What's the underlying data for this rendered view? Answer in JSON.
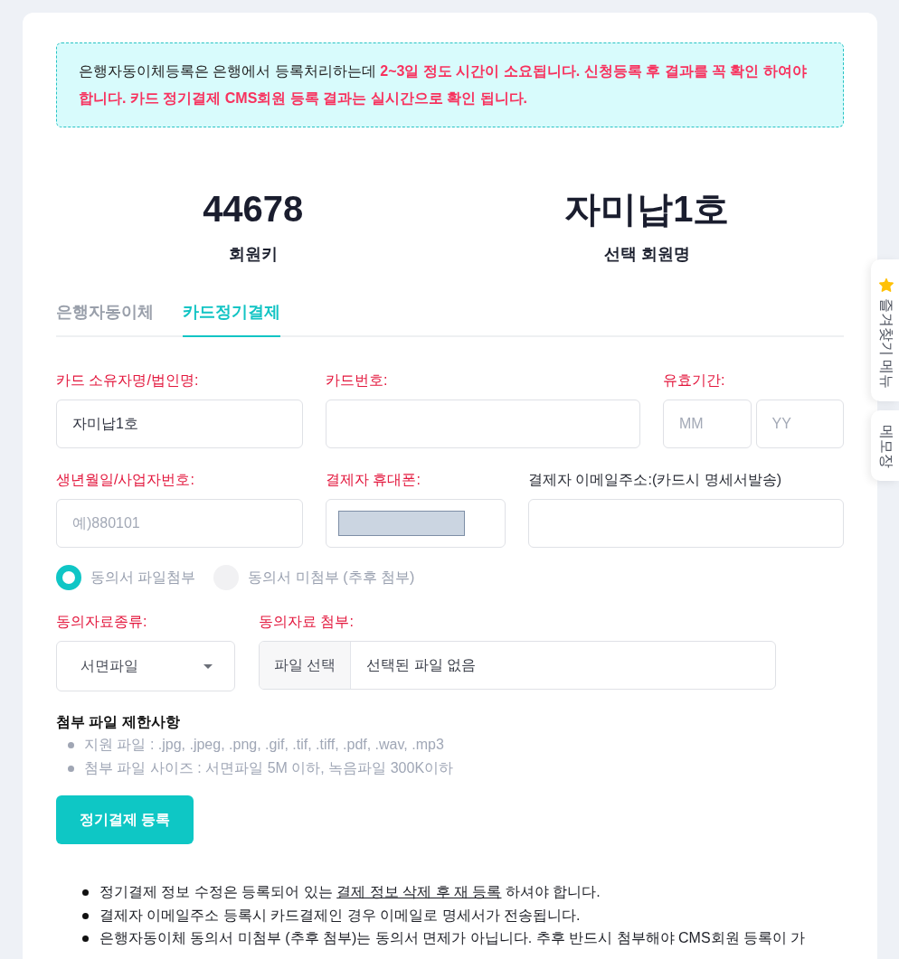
{
  "notice": {
    "parts": [
      {
        "text": "은행자동이체등록은 은행에서 등록처리하는데 ",
        "emphasis": false
      },
      {
        "text": "2~3일 정도 시간이 소요됩니다. 신청등록 후 결과를 꼭 확인 하여야 합니다. 카드 정기결제 CMS회원 등록 결과는 실시간으로 확인 됩니다.",
        "emphasis": true
      }
    ]
  },
  "summary": [
    {
      "value": "44678",
      "label": "회원키"
    },
    {
      "value": "자미납1호",
      "label": "선택 회원명"
    }
  ],
  "tabs": [
    {
      "label": "은행자동이체",
      "selected": false
    },
    {
      "label": "카드정기결제",
      "selected": true
    }
  ],
  "form_rows": [
    [
      {
        "kind": "text",
        "label": "카드 소유자명/법인명:",
        "required": true,
        "value": "자미납1호"
      },
      {
        "kind": "text",
        "label": "카드번호:",
        "required": true
      },
      {
        "kind": "pair",
        "label": "유효기간:",
        "required": true,
        "inputs": [
          {
            "placeholder": "MM"
          },
          {
            "placeholder": "YY"
          }
        ]
      }
    ],
    [
      {
        "kind": "text",
        "label": "생년월일/사업자번호:",
        "required": true,
        "placeholder": "예)880101"
      },
      {
        "kind": "text",
        "label": "결제자 휴대폰:",
        "required": true,
        "masked": true
      },
      {
        "kind": "text",
        "label": "결제자 이메일주소:(카드시 명세서발송)",
        "required": false
      }
    ]
  ],
  "attachment_options": [
    {
      "label": "동의서 파일첨부",
      "selected": true
    },
    {
      "label": "동의서 미첨부 (추후 첨부)",
      "selected": false
    }
  ],
  "consent_type": {
    "label": "동의자료종류:",
    "required": true,
    "value": "서면파일"
  },
  "consent_file": {
    "label": "동의자료 첨부:",
    "required": true,
    "button": "파일 선택",
    "status": "선택된 파일 없음"
  },
  "restrictions": {
    "title": "첨부 파일 제한사항",
    "items": [
      "지원 파일 : .jpg, .jpeg, .png, .gif, .tif, .tiff, .pdf, .wav, .mp3",
      "첨부 파일 사이즈 : 서면파일 5M 이하, 녹음파일 300K이하"
    ]
  },
  "submit_button": "정기결제 등록",
  "notes": [
    {
      "parts": [
        {
          "text": "정기결제 정보 수정은 등록되어 있는 ",
          "underlined": false
        },
        {
          "text": "결제 정보 삭제 후 재 등록",
          "underlined": true
        },
        {
          "text": " 하셔야 합니다.",
          "underlined": false
        }
      ]
    },
    {
      "parts": [
        {
          "text": "결제자 이메일주소 등록시 카드결제인 경우 이메일로 명세서가 전송됩니다.",
          "underlined": false
        }
      ]
    },
    {
      "parts": [
        {
          "text": "은행자동이체 동의서 미첨부 (추후 첨부)는 동의서 면제가 아닙니다. 추후 반드시 첨부해야 CMS회원 등록이 가",
          "underlined": false
        }
      ]
    }
  ],
  "side_tabs": [
    {
      "kind": "favorites",
      "label": "즐겨찾기 메뉴"
    },
    {
      "kind": "memo",
      "label": "메모장"
    }
  ]
}
